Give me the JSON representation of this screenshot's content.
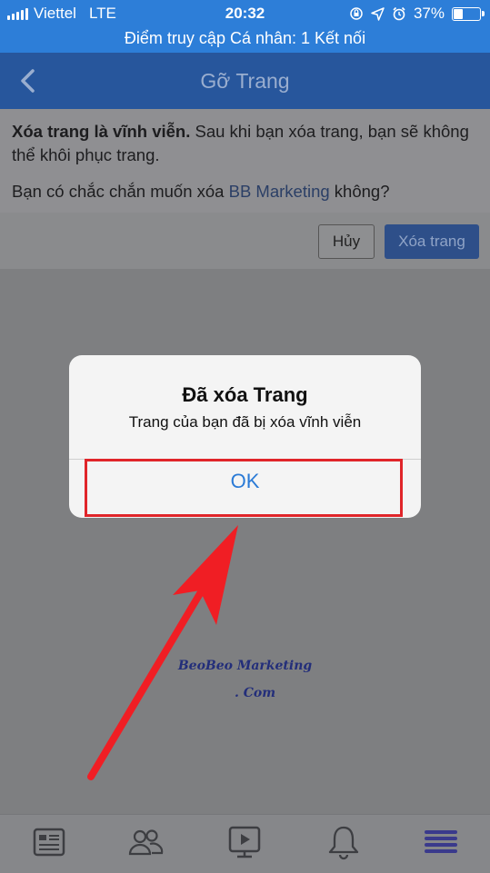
{
  "status_bar": {
    "carrier": "Viettel",
    "network": "LTE",
    "time": "20:32",
    "battery": "37%",
    "battery_level": 0.37,
    "icons": [
      "signal-icon",
      "orientation-lock-icon",
      "location-icon",
      "alarm-icon",
      "battery-icon"
    ]
  },
  "hotspot_banner": "Điểm truy cập Cá nhân: 1 Kết nối",
  "nav": {
    "title": "Gỡ Trang",
    "back_icon": "chevron-left-icon"
  },
  "content": {
    "warning_bold": "Xóa trang là vĩnh viễn.",
    "warning_text": " Sau khi bạn xóa trang, bạn sẽ không thể khôi phục trang.",
    "question_prefix": "Bạn có chắc chắn muốn xóa ",
    "page_name": "BB Marketing",
    "question_suffix": " không?"
  },
  "actions": {
    "cancel_label": "Hủy",
    "delete_label": "Xóa trang"
  },
  "dialog": {
    "title": "Đã xóa Trang",
    "message": "Trang của bạn đã bị xóa vĩnh viễn",
    "ok_label": "OK"
  },
  "watermark": {
    "line1": "BeoBeo Marketing",
    "line2": ". Com"
  },
  "tab_bar": {
    "tabs": [
      "news-feed-icon",
      "friends-icon",
      "video-icon",
      "notifications-icon",
      "menu-icon"
    ]
  },
  "colors": {
    "status_blue": "#2d7ed8",
    "nav_blue": "#27569c",
    "ok_blue": "#2a7ad6",
    "highlight_red": "#e0252a",
    "arrow_red": "#f01e24",
    "menu_active": "#3a3a8c"
  }
}
